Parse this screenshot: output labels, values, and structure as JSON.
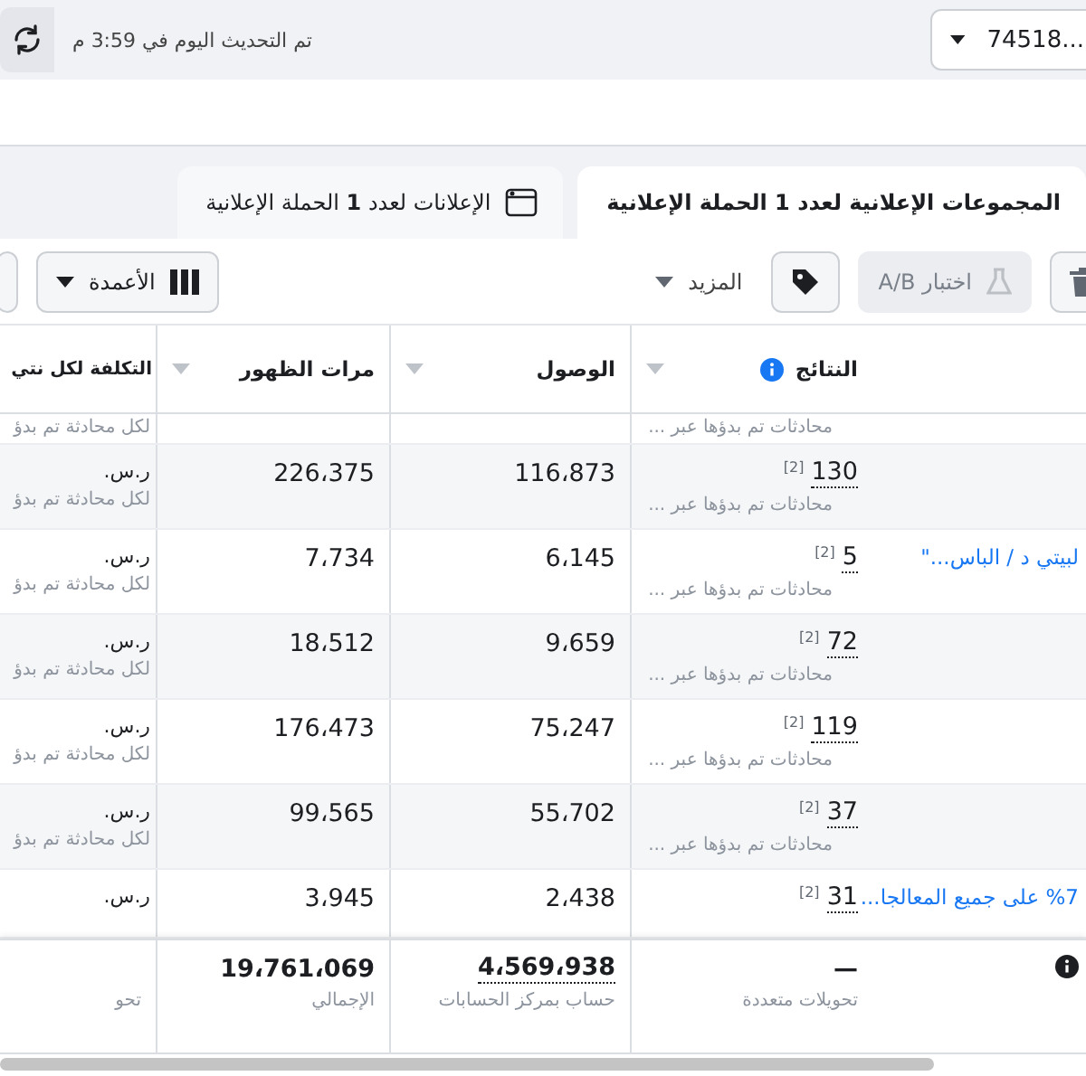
{
  "top_bar": {
    "account": "...74518",
    "updated": "تم التحديث اليوم في 3:59 م"
  },
  "tabs": [
    {
      "label": "المجموعات الإعلانية لعدد **1** الحملة الإعلانية",
      "selected": true,
      "kind": "plain"
    },
    {
      "label": "الإعلانات لعدد **1** الحملة الإعلانية",
      "selected": false,
      "kind": "window"
    }
  ],
  "toolbar": {
    "ab_test": {
      "label": "اختبار A/B",
      "disabled": true
    },
    "more": "المزيد",
    "columns": "الأعمدة"
  },
  "table": {
    "columns": [
      {
        "label": "النتائج",
        "info": true
      },
      {
        "label": "الوصول"
      },
      {
        "label": "مرات الظهور"
      },
      {
        "label": "التكلفة لكل نتي"
      }
    ],
    "rows": [
      {
        "kind": "partial",
        "name": "",
        "results": "",
        "note": "",
        "results_sub": "محادثات تم بدؤها عبر ...",
        "reach": "",
        "impressions": "",
        "cost": "",
        "cost_sub": "لكل محادثة تم بدؤ"
      },
      {
        "kind": "full",
        "name": "",
        "results": "130",
        "note": "[2]",
        "results_sub": "محادثات تم بدؤها عبر ...",
        "reach": "116،873",
        "impressions": "226،375",
        "cost": "ر.س.",
        "cost_sub": "لكل محادثة تم بدؤ"
      },
      {
        "kind": "full",
        "name": "لبيتي د / الباس...\"",
        "results": "5",
        "note": "[2]",
        "results_sub": "محادثات تم بدؤها عبر ...",
        "reach": "6،145",
        "impressions": "7،734",
        "cost": "ر.س.",
        "cost_sub": "لكل محادثة تم بدؤ"
      },
      {
        "kind": "full",
        "name": "",
        "results": "72",
        "note": "[2]",
        "results_sub": "محادثات تم بدؤها عبر ...",
        "reach": "9،659",
        "impressions": "18،512",
        "cost": "ر.س.",
        "cost_sub": "لكل محادثة تم بدؤ"
      },
      {
        "kind": "full",
        "name": "",
        "results": "119",
        "note": "[2]",
        "results_sub": "محادثات تم بدؤها عبر ...",
        "reach": "75،247",
        "impressions": "176،473",
        "cost": "ر.س.",
        "cost_sub": "لكل محادثة تم بدؤ"
      },
      {
        "kind": "full",
        "name": "",
        "results": "37",
        "note": "[2]",
        "results_sub": "محادثات تم بدؤها عبر ...",
        "reach": "55،702",
        "impressions": "99،565",
        "cost": "ر.س.",
        "cost_sub": "لكل محادثة تم بدؤ"
      },
      {
        "kind": "full",
        "name": "%7 على جميع المعالجا...",
        "results": "31",
        "note": "[2]",
        "results_sub": "",
        "reach": "2،438",
        "impressions": "3،945",
        "cost": "ر.س.",
        "cost_sub": ""
      }
    ],
    "totals": {
      "results": "—",
      "results_sub": "تحويلات متعددة",
      "reach": "4،569،938",
      "reach_sub": "حساب بمركز الحسابات",
      "impressions": "19،761،069",
      "impressions_sub": "الإجمالي",
      "cost_sub": "تحو"
    }
  }
}
